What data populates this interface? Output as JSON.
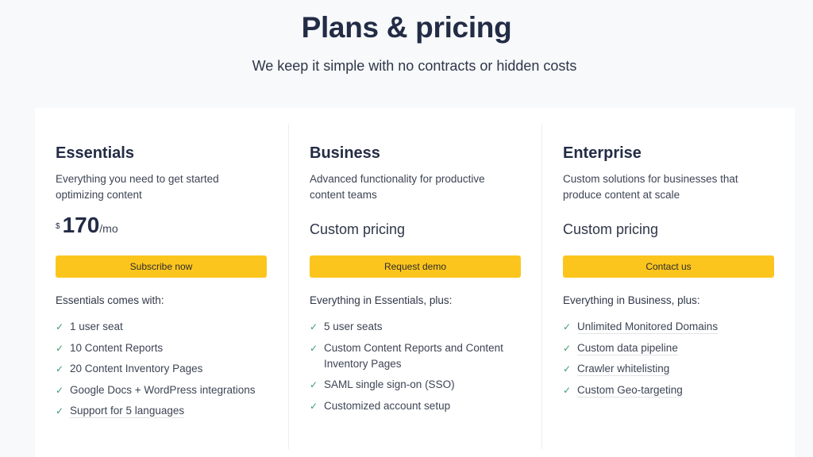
{
  "header": {
    "title": "Plans & pricing",
    "subtitle": "We keep it simple with no contracts or hidden costs"
  },
  "colors": {
    "accent": "#fcc51e",
    "check": "#3f9b6e",
    "heading": "#232c45"
  },
  "plans": [
    {
      "name": "Essentials",
      "description": "Everything you need to get started optimizing content",
      "price": {
        "currency": "$",
        "amount": "170",
        "period": "/mo"
      },
      "cta": "Subscribe now",
      "includes_label": "Essentials comes with:",
      "features": [
        "1 user seat",
        "10 Content Reports",
        "20 Content Inventory Pages",
        "Google Docs + WordPress integrations",
        "Support for 5 languages"
      ]
    },
    {
      "name": "Business",
      "description": "Advanced functionality for productive content teams",
      "price_text": "Custom pricing",
      "cta": "Request demo",
      "includes_label": "Everything in Essentials, plus:",
      "features": [
        "5 user seats",
        "Custom Content Reports and Content Inventory Pages",
        "SAML single sign-on (SSO)",
        "Customized account setup"
      ]
    },
    {
      "name": "Enterprise",
      "description": "Custom solutions for businesses that produce content at scale",
      "price_text": "Custom pricing",
      "cta": "Contact us",
      "includes_label": "Everything in Business, plus:",
      "features": [
        "Unlimited Monitored Domains",
        "Custom data pipeline",
        "Crawler whitelisting",
        "Custom Geo-targeting"
      ]
    }
  ],
  "icons": {
    "check": "✓"
  }
}
